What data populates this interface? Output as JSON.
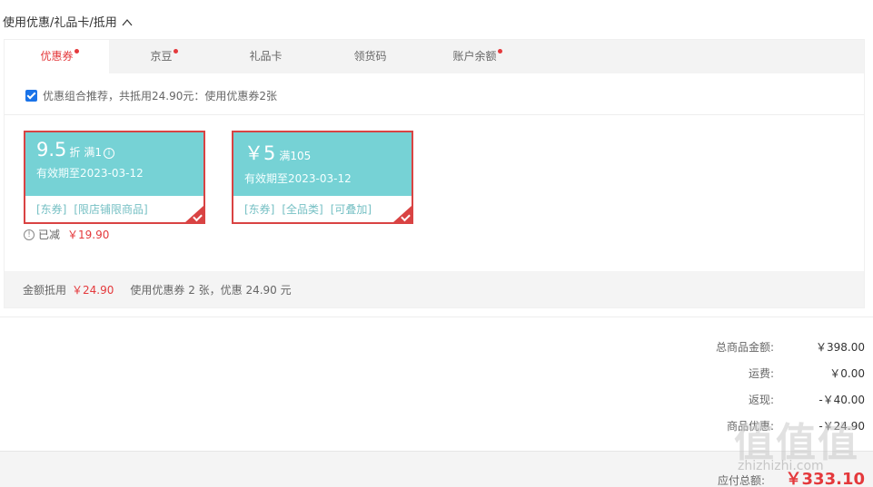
{
  "section": {
    "title": "使用优惠/礼品卡/抵用"
  },
  "tabs": [
    {
      "label": "优惠券",
      "dot": true,
      "active": true
    },
    {
      "label": "京豆",
      "dot": true
    },
    {
      "label": "礼品卡",
      "dot": false
    },
    {
      "label": "领货码",
      "dot": false
    },
    {
      "label": "账户余额",
      "dot": true
    }
  ],
  "recommend": {
    "text": "优惠组合推荐，共抵用24.90元：使用优惠券2张",
    "checked": true
  },
  "coupons": [
    {
      "value": "9.5",
      "unit": "折",
      "condition": "满1",
      "expiry": "有效期至2023-03-12",
      "tags": [
        "[东券]",
        "[限店铺限商品]"
      ],
      "selected": true
    },
    {
      "value": "￥5",
      "unit": "",
      "condition": "满105",
      "expiry": "有效期至2023-03-12",
      "tags": [
        "[东券]",
        "[全品类]",
        "[可叠加]"
      ],
      "selected": true
    }
  ],
  "saved": {
    "label": "已减",
    "amount": "￥19.90"
  },
  "summary": {
    "label": "金额抵用",
    "amount": "￥24.90",
    "detail": "使用优惠券 2 张，优惠 24.90 元"
  },
  "totals": [
    {
      "label": "总商品金额:",
      "value": "￥398.00"
    },
    {
      "label": "运费:",
      "value": "￥0.00"
    },
    {
      "label": "返现:",
      "value": "-￥40.00"
    },
    {
      "label": "商品优惠:",
      "value": "-￥24.90"
    }
  ],
  "payable": {
    "label": "应付总额:",
    "value": "￥333.10"
  },
  "watermark": {
    "text": "值值值",
    "sub": "zhizhizhi.com"
  },
  "colors": {
    "accent": "#e4393c",
    "coupon": "#76d2d5",
    "couponBorder": "#d94343",
    "checkbox": "#1a73e8"
  }
}
